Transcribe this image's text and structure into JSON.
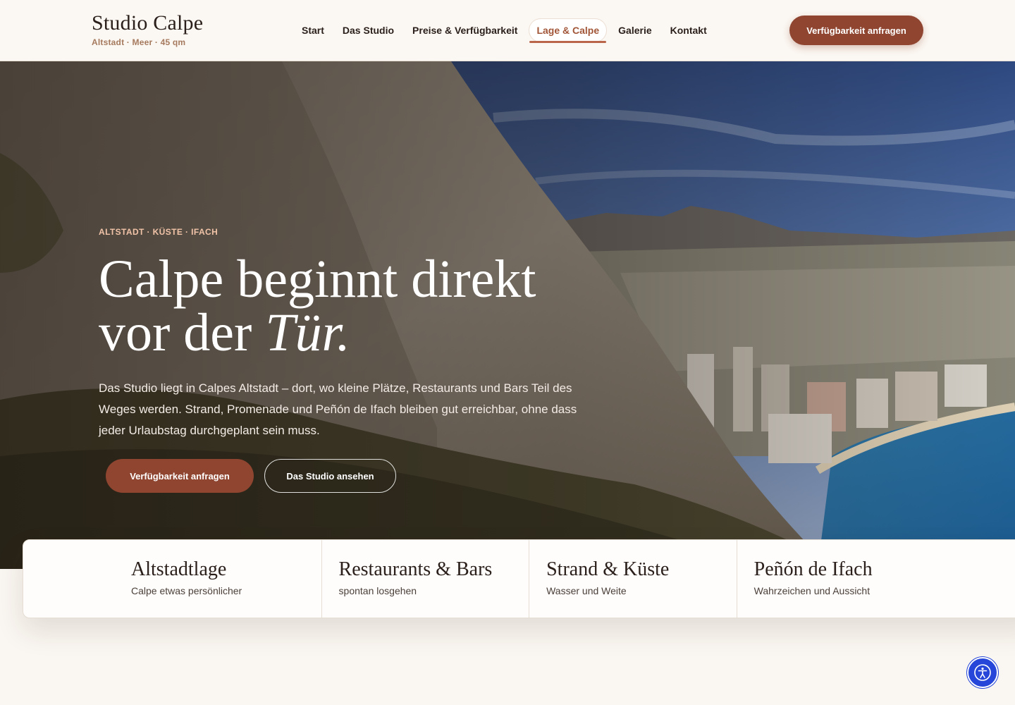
{
  "header": {
    "brand_title": "Studio Calpe",
    "brand_sub": "Altstadt · Meer · 45 qm",
    "nav": [
      {
        "label": "Start"
      },
      {
        "label": "Das Studio"
      },
      {
        "label": "Preise & Verfügbarkeit"
      },
      {
        "label": "Lage & Calpe",
        "active": true
      },
      {
        "label": "Galerie"
      },
      {
        "label": "Kontakt"
      }
    ],
    "cta_label": "Verfügbarkeit anfragen"
  },
  "hero": {
    "eyebrow": "ALTSTADT · KÜSTE · IFACH",
    "title_line1": "Calpe beginnt direkt",
    "title_line2_prefix": "vor der ",
    "title_line2_italic": "Tür.",
    "text": "Das Studio liegt in Calpes Altstadt – dort, wo kleine Plätze, Restaurants und Bars Teil des Weges werden. Strand, Promenade und Peñón de Ifach bleiben gut erreichbar, ohne dass jeder Urlaubstag durchgeplant sein muss.",
    "primary_button": "Verfügbarkeit anfragen",
    "secondary_button": "Das Studio ansehen"
  },
  "features": [
    {
      "title": "Altstadtlage",
      "sub": "Calpe etwas persönlicher"
    },
    {
      "title": "Restaurants & Bars",
      "sub": "spontan losgehen"
    },
    {
      "title": "Strand & Küste",
      "sub": "Wasser und Weite"
    },
    {
      "title": "Peñón de Ifach",
      "sub": "Wahrzeichen und Aussicht"
    }
  ],
  "icons": {
    "accessibility": "accessibility-icon"
  },
  "colors": {
    "accent": "#8f4530",
    "nav_active": "#a25638",
    "a11y_button": "#2546d8"
  }
}
